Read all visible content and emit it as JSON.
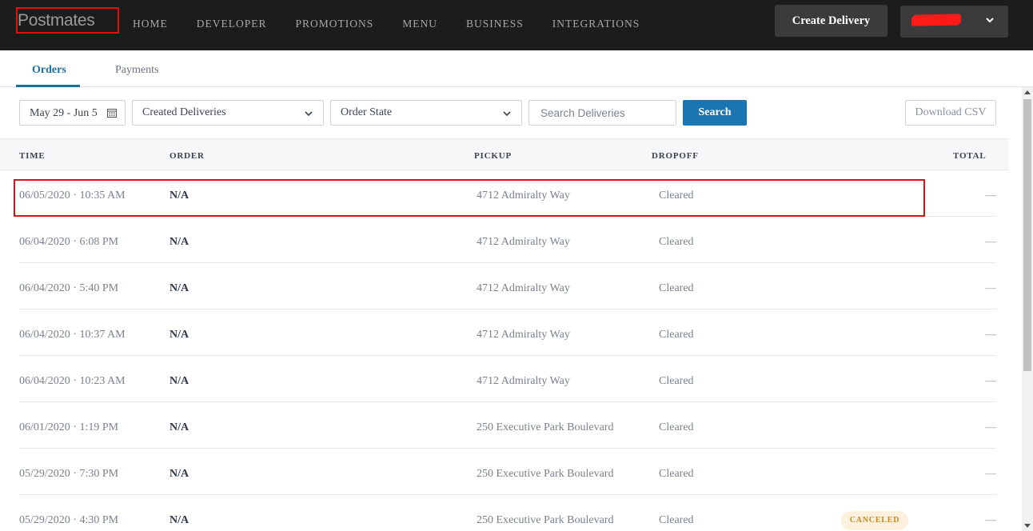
{
  "header": {
    "logo": "Postmates",
    "nav": [
      "HOME",
      "DEVELOPER",
      "PROMOTIONS",
      "MENU",
      "BUSINESS",
      "INTEGRATIONS"
    ],
    "create_delivery_label": "Create Delivery",
    "account_menu_icon": "chevron-down-icon"
  },
  "tabs": [
    "Orders",
    "Payments"
  ],
  "filters": {
    "date_range": "May 29 - Jun 5",
    "deliveries_select": "Created Deliveries",
    "order_state_select": "Order State",
    "search_placeholder": "Search Deliveries",
    "search_label": "Search",
    "download_label": "Download CSV"
  },
  "table": {
    "columns": [
      "TIME",
      "ORDER",
      "PICKUP",
      "DROPOFF",
      "TOTAL"
    ],
    "rows": [
      {
        "time": "06/05/2020 · 10:35 AM",
        "order": "N/A",
        "pickup": "4712 Admiralty Way",
        "dropoff": "Cleared",
        "status": "",
        "total": "—"
      },
      {
        "time": "06/04/2020 · 6:08 PM",
        "order": "N/A",
        "pickup": "4712 Admiralty Way",
        "dropoff": "Cleared",
        "status": "",
        "total": "—"
      },
      {
        "time": "06/04/2020 · 5:40 PM",
        "order": "N/A",
        "pickup": "4712 Admiralty Way",
        "dropoff": "Cleared",
        "status": "",
        "total": "—"
      },
      {
        "time": "06/04/2020 · 10:37 AM",
        "order": "N/A",
        "pickup": "4712 Admiralty Way",
        "dropoff": "Cleared",
        "status": "",
        "total": "—"
      },
      {
        "time": "06/04/2020 · 10:23 AM",
        "order": "N/A",
        "pickup": "4712 Admiralty Way",
        "dropoff": "Cleared",
        "status": "",
        "total": "—"
      },
      {
        "time": "06/01/2020 · 1:19 PM",
        "order": "N/A",
        "pickup": "250 Executive Park Boulevard",
        "dropoff": "Cleared",
        "status": "",
        "total": "—"
      },
      {
        "time": "05/29/2020 · 7:30 PM",
        "order": "N/A",
        "pickup": "250 Executive Park Boulevard",
        "dropoff": "Cleared",
        "status": "",
        "total": "—"
      },
      {
        "time": "05/29/2020 · 4:30 PM",
        "order": "N/A",
        "pickup": "250 Executive Park Boulevard",
        "dropoff": "Cleared",
        "status": "CANCELED",
        "total": "—"
      }
    ]
  },
  "colors": {
    "accent": "#1a75b0",
    "header_bg": "#1c1c1c",
    "annotation": "#e01010",
    "canceled_badge": "#c88a1f"
  }
}
